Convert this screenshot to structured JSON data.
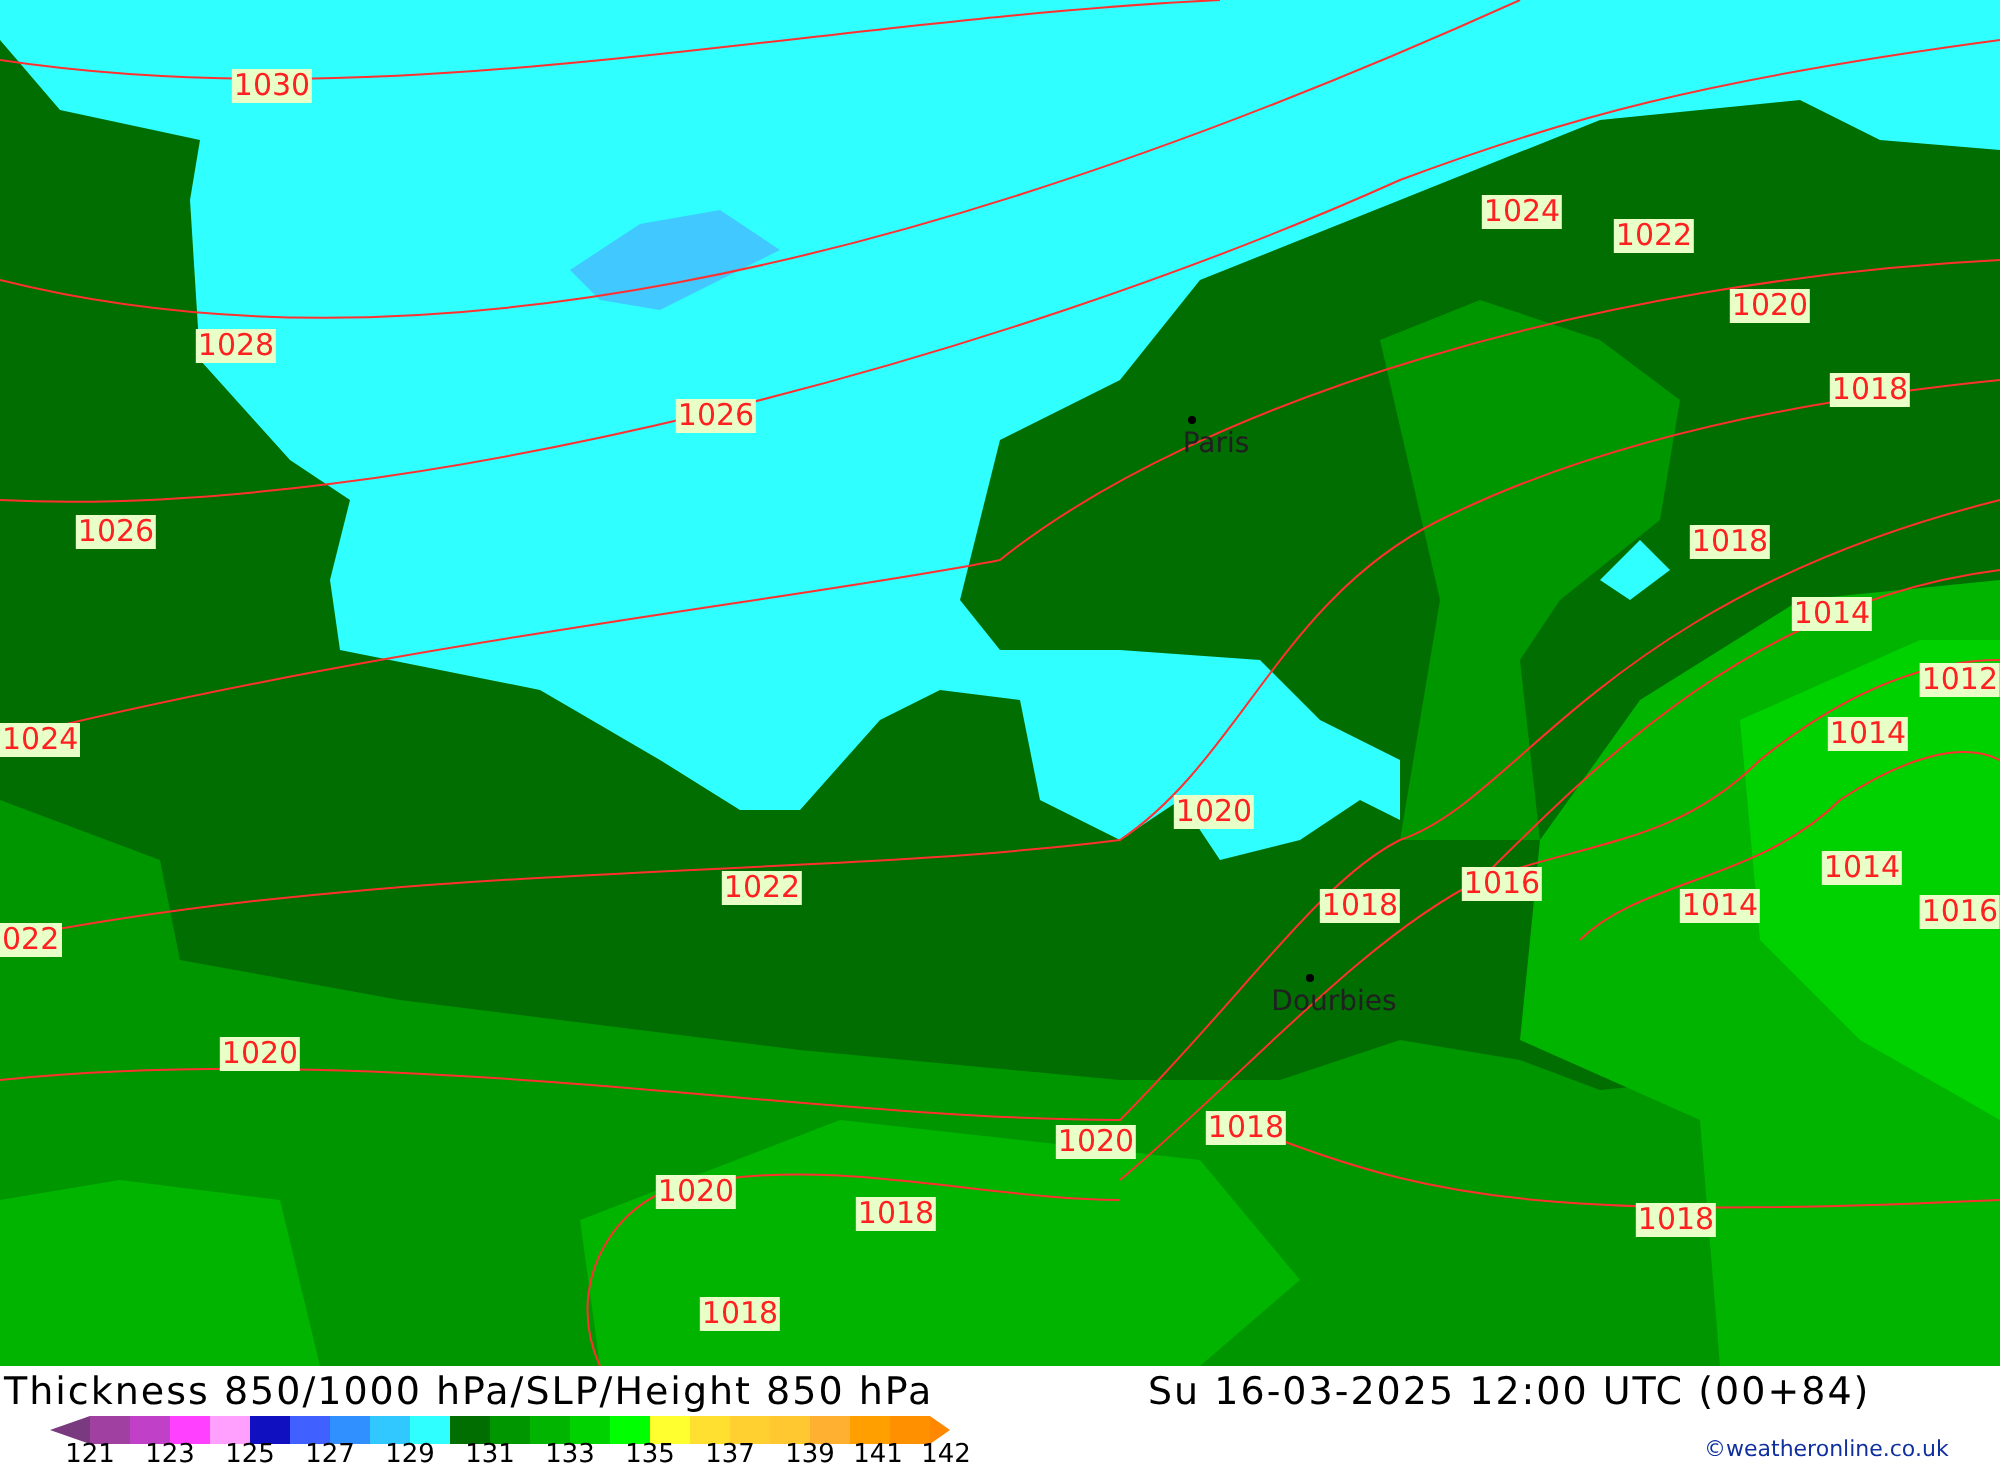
{
  "map": {
    "isobar_labels": [
      "1030",
      "1028",
      "1026",
      "1026",
      "1024",
      "022",
      "1024",
      "1022",
      "1020",
      "1018",
      "1018",
      "1014",
      "1012",
      "1014",
      "1020",
      "1022",
      "1018",
      "1016",
      "1014",
      "1014",
      "1016",
      "1020",
      "1020",
      "1018",
      "1020",
      "1018",
      "1018",
      "1018"
    ],
    "cities": [
      {
        "name": "Paris"
      },
      {
        "name": "Dourbies"
      }
    ]
  },
  "footer": {
    "title": "Thickness 850/1000 hPa/SLP/Height 850 hPa",
    "datetime": "Su 16-03-2025 12:00 UTC (00+84)",
    "legend": {
      "swatches": [
        {
          "kind": "start",
          "color": "#7a3a80"
        },
        {
          "kind": "band",
          "color": "#a040a0"
        },
        {
          "kind": "band",
          "color": "#c040c8"
        },
        {
          "kind": "band",
          "color": "#ff40ff"
        },
        {
          "kind": "band",
          "color": "#ffa0ff"
        },
        {
          "kind": "band",
          "color": "#1010c0"
        },
        {
          "kind": "band",
          "color": "#4060ff"
        },
        {
          "kind": "band",
          "color": "#3090ff"
        },
        {
          "kind": "band",
          "color": "#30c8ff"
        },
        {
          "kind": "band",
          "color": "#30ffff"
        },
        {
          "kind": "band",
          "color": "#006e00"
        },
        {
          "kind": "band",
          "color": "#009600"
        },
        {
          "kind": "band",
          "color": "#00b400"
        },
        {
          "kind": "band",
          "color": "#00d200"
        },
        {
          "kind": "band",
          "color": "#00ff00"
        },
        {
          "kind": "band",
          "color": "#ffff30"
        },
        {
          "kind": "band",
          "color": "#ffe030"
        },
        {
          "kind": "band",
          "color": "#ffd030"
        },
        {
          "kind": "band",
          "color": "#ffc830"
        },
        {
          "kind": "band",
          "color": "#ffb030"
        },
        {
          "kind": "band",
          "color": "#ffa000"
        },
        {
          "kind": "band",
          "color": "#ff9000"
        },
        {
          "kind": "end",
          "color": "#ff8800"
        }
      ],
      "labels": [
        "121",
        "123",
        "125",
        "127",
        "129",
        "131",
        "133",
        "135",
        "137",
        "139",
        "141",
        "142"
      ]
    },
    "credit": "©weatheronline.co.uk"
  }
}
